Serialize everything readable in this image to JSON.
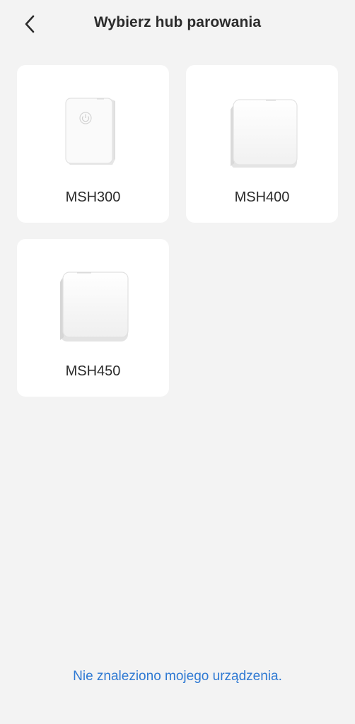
{
  "header": {
    "title": "Wybierz hub parowania",
    "back_icon": "chevron-left-icon"
  },
  "hubs": [
    {
      "label": "MSH300",
      "icon": "msh300-device-image"
    },
    {
      "label": "MSH400",
      "icon": "msh400-device-image"
    },
    {
      "label": "MSH450",
      "icon": "msh450-device-image"
    }
  ],
  "footer": {
    "not_found_link": "Nie znaleziono mojego urządzenia."
  },
  "colors": {
    "background": "#f3f3f3",
    "card": "#ffffff",
    "link": "#2e79d3"
  }
}
